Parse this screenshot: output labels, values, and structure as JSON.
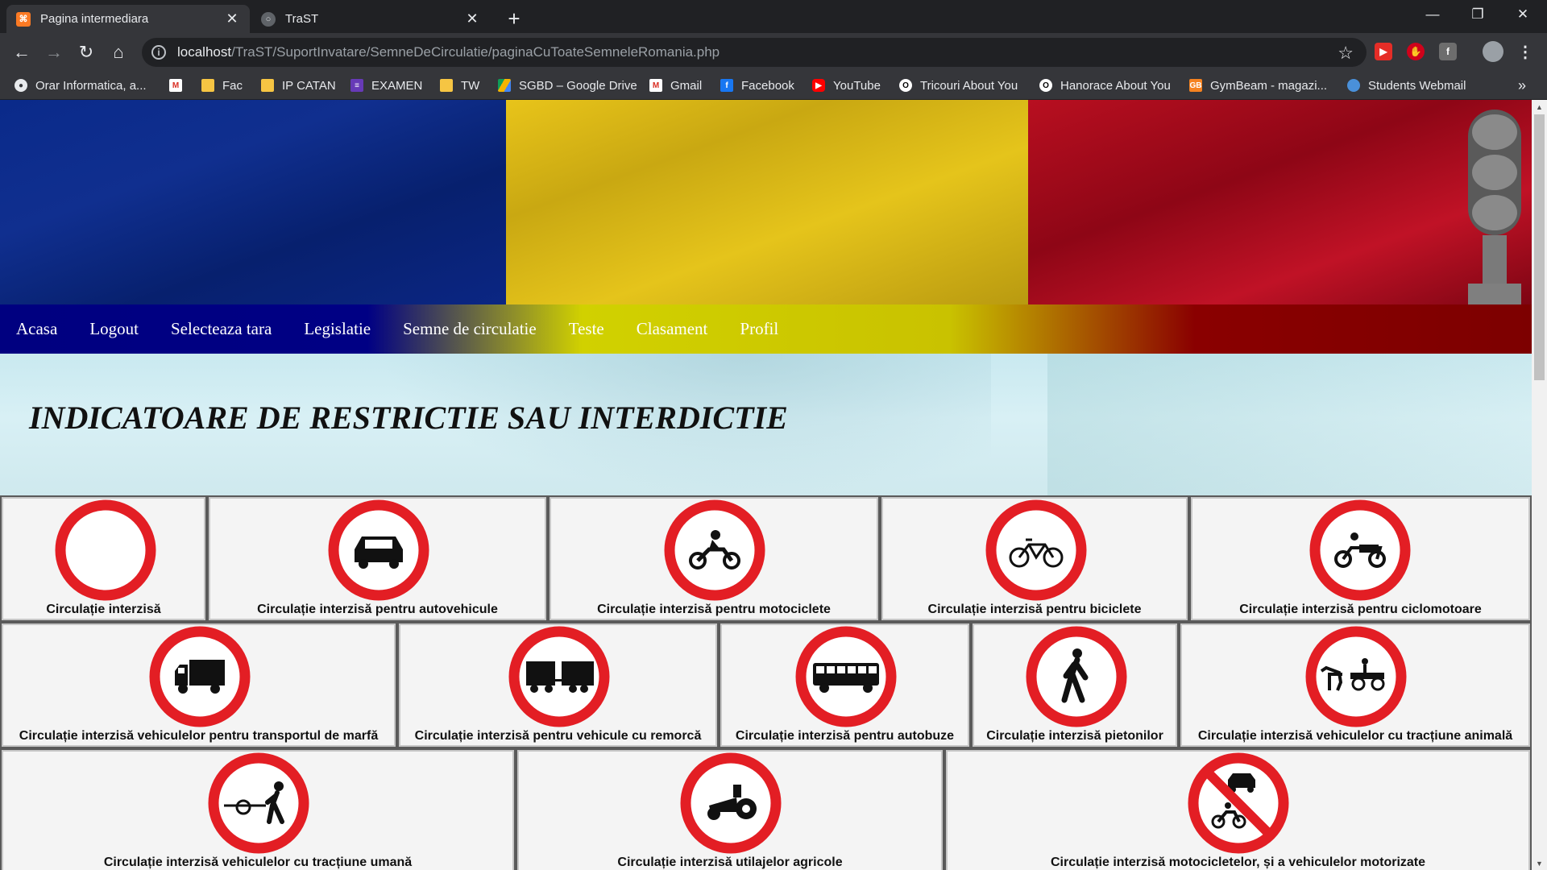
{
  "browser": {
    "tabs": [
      {
        "title": "Pagina intermediara",
        "active": true,
        "favicon": "xampp-icon"
      },
      {
        "title": "TraST",
        "active": false,
        "favicon": "globe-icon"
      }
    ],
    "url_host": "localhost",
    "url_path": "/TraST/SuportInvatare/SemneDeCirculatie/paginaCuToateSemneleRomania.php",
    "bookmarks": [
      "Orar Informatica, a...",
      "",
      "Fac",
      "IP CATAN",
      "EXAMEN",
      "TW",
      "SGBD – Google Drive",
      "Gmail",
      "Facebook",
      "YouTube",
      "Tricouri About You",
      "Hanorace About You",
      "GymBeam - magazi...",
      "Students Webmail"
    ],
    "more_bookmarks": "»"
  },
  "nav": {
    "items": [
      "Acasa",
      "Logout",
      "Selecteaza tara",
      "Legislatie",
      "Semne de circulatie",
      "Teste",
      "Clasament",
      "Profil"
    ]
  },
  "page": {
    "heading": "INDICATOARE DE RESTRICTIE SAU INTERDICTIE"
  },
  "signs": [
    {
      "caption": "Circulație interzisă",
      "icon": "empty"
    },
    {
      "caption": "Circulație interzisă pentru autovehicule",
      "icon": "car"
    },
    {
      "caption": "Circulație interzisă pentru motociclete",
      "icon": "motorcycle"
    },
    {
      "caption": "Circulație interzisă pentru biciclete",
      "icon": "bicycle"
    },
    {
      "caption": "Circulație interzisă pentru ciclomotoare",
      "icon": "moped"
    },
    {
      "caption": "Circulație interzisă vehiculelor pentru transportul de marfă",
      "icon": "truck"
    },
    {
      "caption": "Circulație interzisă pentru vehicule cu remorcă",
      "icon": "trailer"
    },
    {
      "caption": "Circulație interzisă pentru autobuze",
      "icon": "bus"
    },
    {
      "caption": "Circulație interzisă pietonilor",
      "icon": "pedestrian"
    },
    {
      "caption": "Circulație interzisă vehiculelor cu tracțiune animală",
      "icon": "horse-cart"
    },
    {
      "caption": "Circulație interzisă vehiculelor cu tracțiune umană",
      "icon": "handcart"
    },
    {
      "caption": "Circulație interzisă utilajelor agricole",
      "icon": "tractor"
    },
    {
      "caption": "Circulație interzisă motocicletelor, și a vehiculelor motorizate",
      "icon": "car-and-motorcycle"
    }
  ],
  "colors": {
    "sign_red": "#e31e24",
    "nav_blue": "#000080",
    "nav_yellow": "#d1d100",
    "nav_red": "#8a0000"
  }
}
